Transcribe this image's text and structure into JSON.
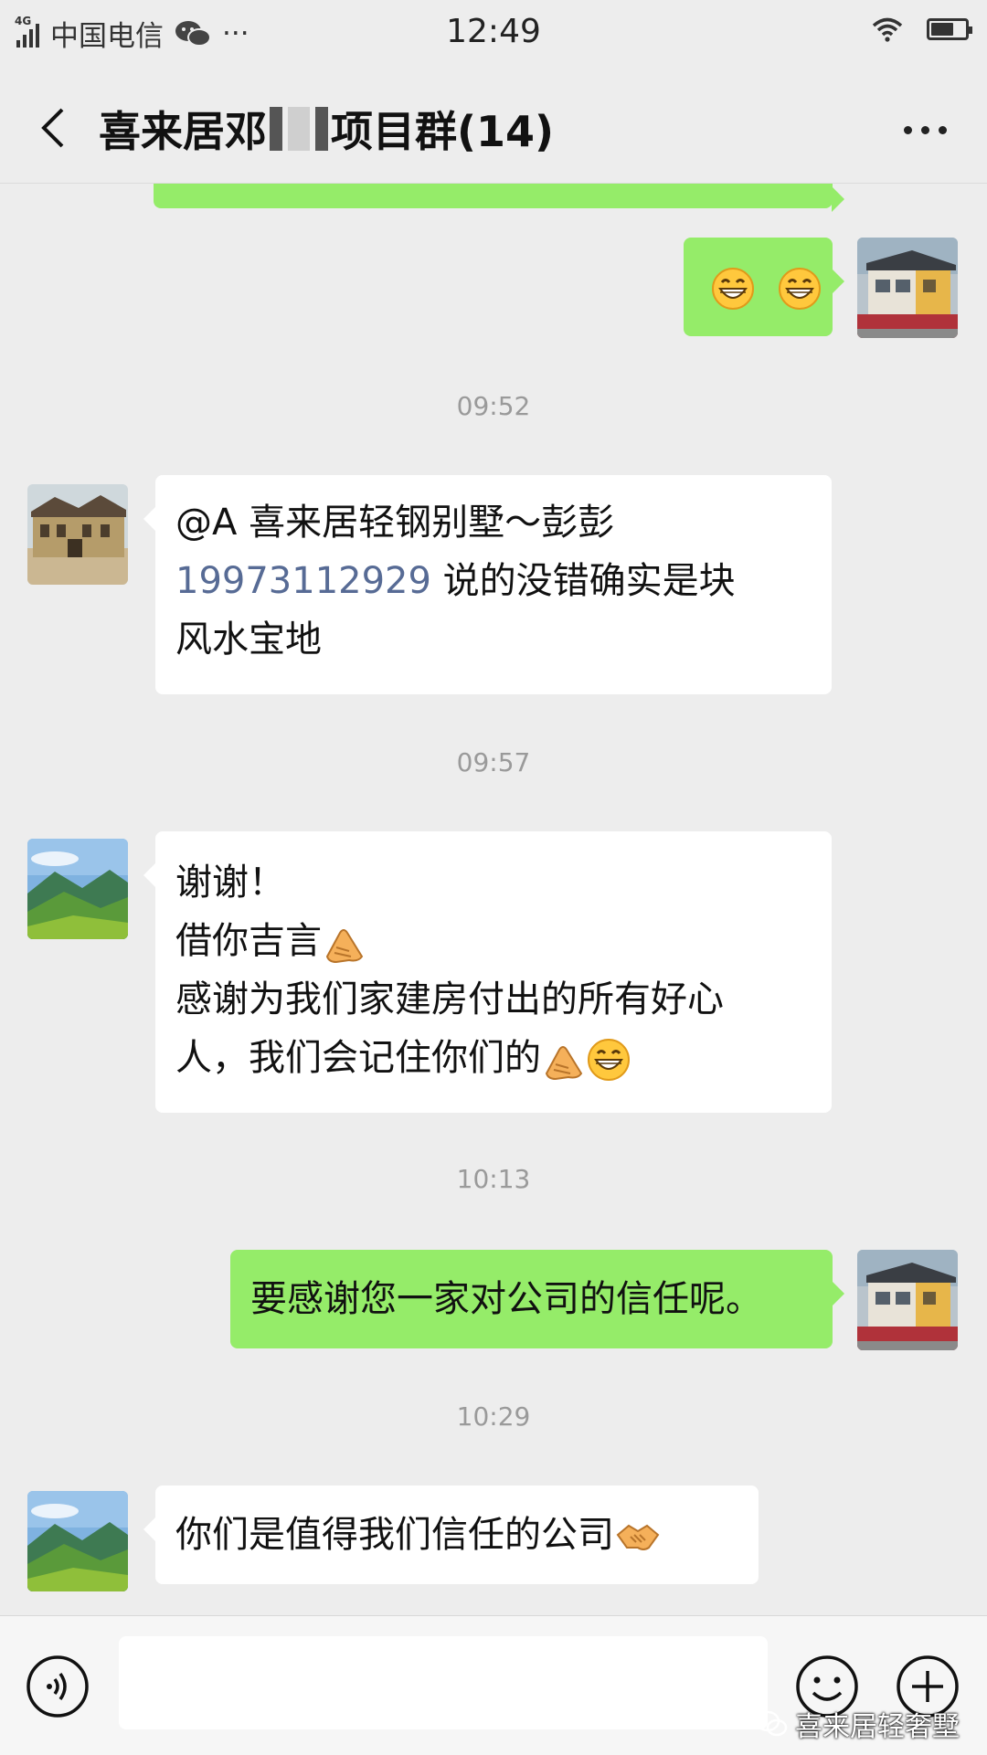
{
  "status_bar": {
    "network": "4G",
    "carrier": "中国电信",
    "more": "···",
    "time": "12:49"
  },
  "header": {
    "title_part1": "喜来居邓",
    "title_part2": "项目群(14)"
  },
  "messages": [
    {
      "side": "right",
      "type": "emoji",
      "content": [
        "grinning-face",
        "grinning-face"
      ]
    },
    {
      "type": "timestamp",
      "text": "09:52"
    },
    {
      "side": "left",
      "line1": "@A 喜来居轻钢别墅～彭彭",
      "phone": "19973112929",
      "line2_rest": " 说的没错确实是块",
      "line3": "风水宝地"
    },
    {
      "type": "timestamp",
      "text": "09:57"
    },
    {
      "side": "left",
      "line1": "谢谢！",
      "line2": "借你吉言",
      "line3": "感谢为我们家建房付出的所有好心",
      "line4": "人，我们会记住你们的"
    },
    {
      "type": "timestamp",
      "text": "10:13"
    },
    {
      "side": "right",
      "text": "要感谢您一家对公司的信任呢。"
    },
    {
      "type": "timestamp",
      "text": "10:29"
    },
    {
      "side": "left",
      "text": "你们是值得我们信任的公司"
    }
  ],
  "input_bar": {
    "placeholder": ""
  },
  "watermark": "喜来居轻奢墅",
  "colors": {
    "background": "#ededed",
    "sent_bubble": "#95ec69",
    "received_bubble": "#ffffff",
    "link": "#576b95"
  }
}
